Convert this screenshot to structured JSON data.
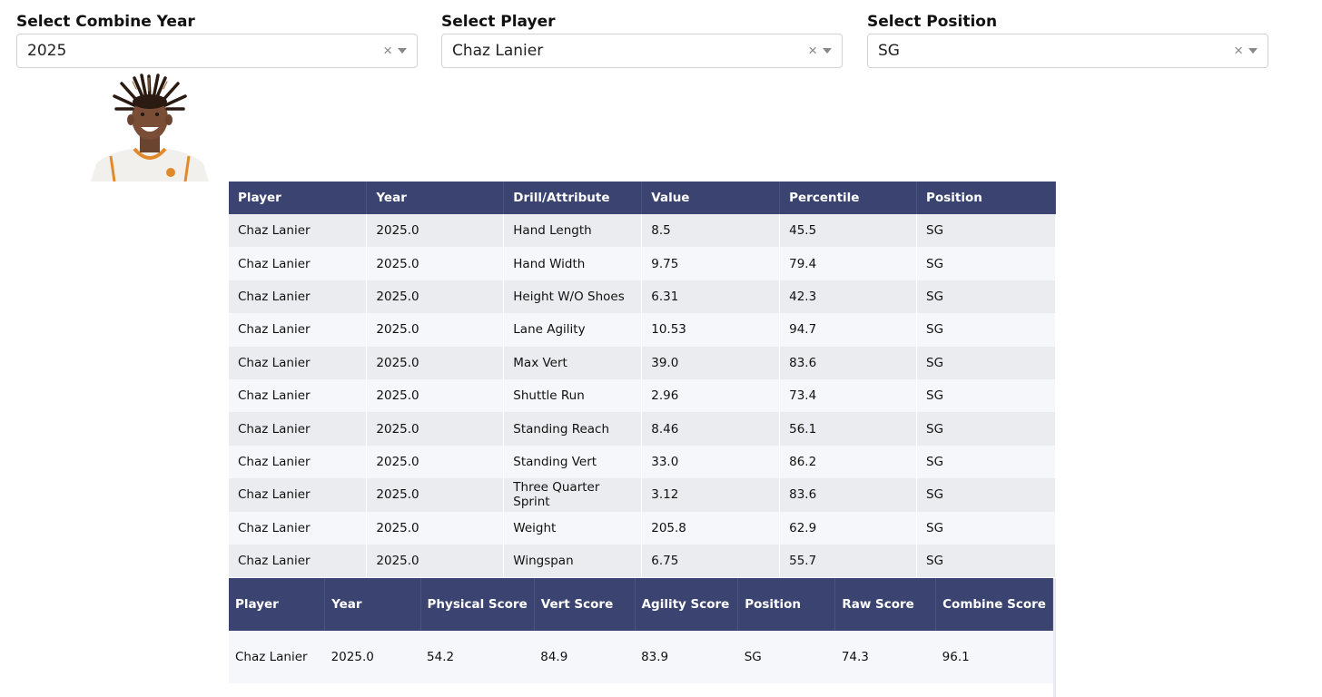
{
  "filters": {
    "year": {
      "label": "Select Combine Year",
      "value": "2025",
      "clear_icon": "×"
    },
    "player": {
      "label": "Select Player",
      "value": "Chaz Lanier",
      "clear_icon": "×"
    },
    "position": {
      "label": "Select Position",
      "value": "SG",
      "clear_icon": "×"
    }
  },
  "player_photo": {
    "icon": "player-headshot"
  },
  "drill_table": {
    "headers": [
      "Player",
      "Year",
      "Drill/Attribute",
      "Value",
      "Percentile",
      "Position"
    ],
    "rows": [
      [
        "Chaz Lanier",
        "2025.0",
        "Hand Length",
        "8.5",
        "45.5",
        "SG"
      ],
      [
        "Chaz Lanier",
        "2025.0",
        "Hand Width",
        "9.75",
        "79.4",
        "SG"
      ],
      [
        "Chaz Lanier",
        "2025.0",
        "Height W/O Shoes",
        "6.31",
        "42.3",
        "SG"
      ],
      [
        "Chaz Lanier",
        "2025.0",
        "Lane Agility",
        "10.53",
        "94.7",
        "SG"
      ],
      [
        "Chaz Lanier",
        "2025.0",
        "Max Vert",
        "39.0",
        "83.6",
        "SG"
      ],
      [
        "Chaz Lanier",
        "2025.0",
        "Shuttle Run",
        "2.96",
        "73.4",
        "SG"
      ],
      [
        "Chaz Lanier",
        "2025.0",
        "Standing Reach",
        "8.46",
        "56.1",
        "SG"
      ],
      [
        "Chaz Lanier",
        "2025.0",
        "Standing Vert",
        "33.0",
        "86.2",
        "SG"
      ],
      [
        "Chaz Lanier",
        "2025.0",
        "Three Quarter Sprint",
        "3.12",
        "83.6",
        "SG"
      ],
      [
        "Chaz Lanier",
        "2025.0",
        "Weight",
        "205.8",
        "62.9",
        "SG"
      ],
      [
        "Chaz Lanier",
        "2025.0",
        "Wingspan",
        "6.75",
        "55.7",
        "SG"
      ]
    ]
  },
  "score_table": {
    "headers": [
      "Player",
      "Year",
      "Physical Score",
      "Vert Score",
      "Agility Score",
      "Position",
      "Raw Score",
      "Combine Score"
    ],
    "rows": [
      [
        "Chaz Lanier",
        "2025.0",
        "54.2",
        "84.9",
        "83.9",
        "SG",
        "74.3",
        "96.1"
      ]
    ]
  },
  "colors": {
    "header_bg": "#3b4470",
    "row_odd": "#ebecef",
    "row_even": "#f5f7fb"
  }
}
